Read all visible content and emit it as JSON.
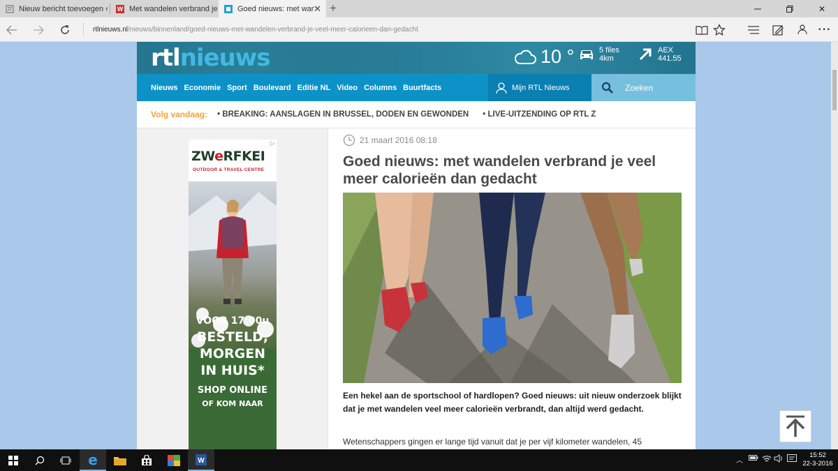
{
  "browser": {
    "tabs": [
      {
        "label": "Nieuw bericht toevoegen ‹ \\",
        "icon": "wordpress-icon"
      },
      {
        "label": "Met wandelen verbrand je v",
        "icon": "w-logo-icon"
      },
      {
        "label": "Goed nieuws: met wandc",
        "icon": "rtl-icon",
        "active": true
      }
    ],
    "url_domain": "rtlnieuws.nl",
    "url_path": "/nieuws/binnenland/goed-nieuws-met-wandelen-verbrand-je-veel-meer-calorieen-dan-gedacht"
  },
  "site": {
    "logo_part1": "rtl",
    "logo_part2": "nieuws",
    "weather_temp": "10 °",
    "traffic_line1": "5 files",
    "traffic_line2": "4km",
    "aex_line1": "AEX",
    "aex_line2": "441.55",
    "nav": [
      "Nieuws",
      "Economie",
      "Sport",
      "Boulevard",
      "Editie NL",
      "Video",
      "Columns",
      "Buurtfacts"
    ],
    "mijn": "Mijn RTL Nieuws",
    "search_placeholder": "Zoeken",
    "follow_label": "Volg vandaag:",
    "follow_items": [
      "• BREAKING: AANSLAGEN IN BRUSSEL, DODEN EN GEWONDEN",
      "• LIVE-UITZENDING OP RTL Z"
    ]
  },
  "ad": {
    "brand_pre": "ZW",
    "brand_e": "e",
    "brand_post": "RFKEI",
    "sub": "OUTDOOR & TRAVEL CENTRE",
    "line1": "VOOR 17:00u",
    "line2": "BESTELD,",
    "line3": "MORGEN",
    "line4": "IN HUIS*",
    "line5": "SHOP ONLINE",
    "line6": "OF KOM NAAR"
  },
  "article": {
    "date": "21 maart 2016 08:18",
    "title": "Goed nieuws: met wandelen verbrand je veel meer calorieën dan gedacht",
    "lead": "Een hekel aan de sportschool of hardlopen? Goed nieuws: uit nieuw onderzoek blijkt dat je met wandelen veel meer calorieën verbrandt, dan altijd werd gedacht.",
    "body": "Wetenschappers gingen er lange tijd vanuit dat je per vijf kilometer wandelen, 45"
  },
  "taskbar": {
    "time": "15:52",
    "date": "22-3-2016"
  },
  "colors": {
    "nav_blue": "#0d92c8",
    "header_teal": "#1f6c86",
    "follow_orange": "#f2a33a",
    "page_bg": "#a9c8ea"
  }
}
